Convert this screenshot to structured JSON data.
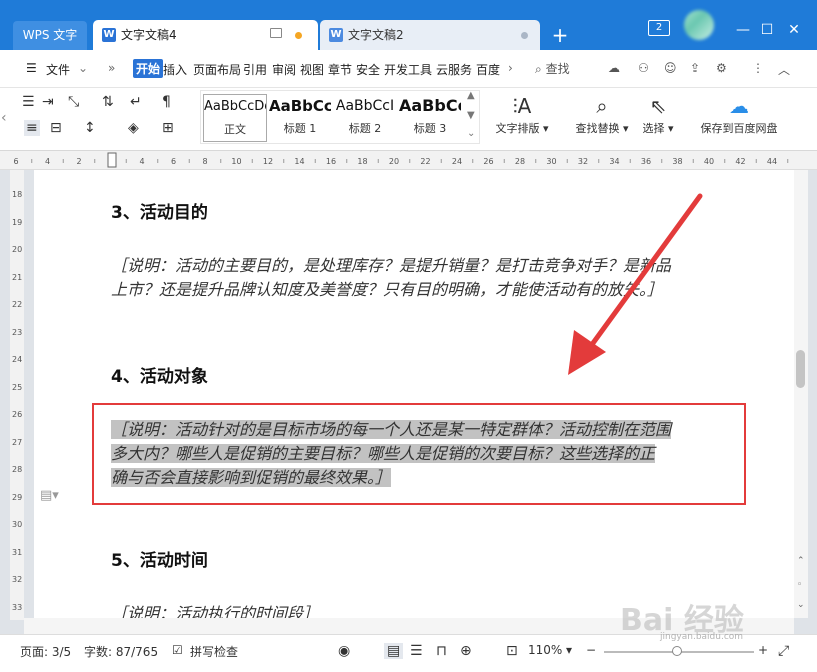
{
  "titlebar": {
    "app_tab": "WPS 文字",
    "tabs": [
      {
        "label": "文字文稿4"
      },
      {
        "label": "文字文稿2"
      }
    ],
    "badge": "2"
  },
  "menu": {
    "file": "文件",
    "items": [
      "开始",
      "插入",
      "页面布局",
      "引用",
      "审阅",
      "视图",
      "章节",
      "安全",
      "开发工具",
      "云服务",
      "百度"
    ],
    "search": "查找"
  },
  "ribbon": {
    "styles": [
      {
        "sample": "AaBbCcDd",
        "label": "正文"
      },
      {
        "sample": "AaBbCcI",
        "label": "标题 1"
      },
      {
        "sample": "AaBbCcI",
        "label": "标题 2"
      },
      {
        "sample": "AaBbCc",
        "label": "标题 3"
      }
    ],
    "text_layout": "文字排版",
    "find_replace": "查找替换",
    "select": "选择",
    "save_baidu": "保存到百度网盘"
  },
  "ruler": {
    "h_numbers": [
      "6",
      "4",
      "2",
      "2",
      "4",
      "6",
      "8",
      "10",
      "12",
      "14",
      "16",
      "18",
      "20",
      "22",
      "24",
      "26",
      "28",
      "30",
      "32",
      "34",
      "36",
      "38",
      "40",
      "42",
      "44"
    ],
    "v_numbers": [
      "18",
      "19",
      "20",
      "21",
      "22",
      "23",
      "24",
      "25",
      "26",
      "27",
      "28",
      "29",
      "30",
      "31",
      "32",
      "33"
    ]
  },
  "document": {
    "heading3": "3、活动目的",
    "para1_line1": "［说明：活动的主要目的，是处理库存？是提升销量？是打击竞争对手？是新品",
    "para1_line2": "上市？还是提升品牌认知度及美誉度？只有目的明确，才能使活动有的放矢。］",
    "heading4": "4、活动对象",
    "para2_line1": "［说明：活动针对的是目标市场的每一个人还是某一特定群体？活动控制在范围",
    "para2_line2": "多大内？哪些人是促销的主要目标？哪些人是促销的次要目标？这些选择的正",
    "para2_line3": "确与否会直接影响到促销的最终效果。］",
    "heading5": "5、活动时间",
    "para3_line1": "［说明：活动执行的时间段］"
  },
  "status": {
    "page": "页面: 3/5",
    "words": "字数: 87/765",
    "spell": "拼写检查",
    "zoom": "110%"
  },
  "watermark": {
    "main": "Bai 经验",
    "sub": "jingyan.baidu.com"
  },
  "colors": {
    "titlebar": "#1f7bd8",
    "accent": "#2a73d6",
    "highlight_box": "#e33b3b",
    "selection": "#c2c2c2"
  }
}
